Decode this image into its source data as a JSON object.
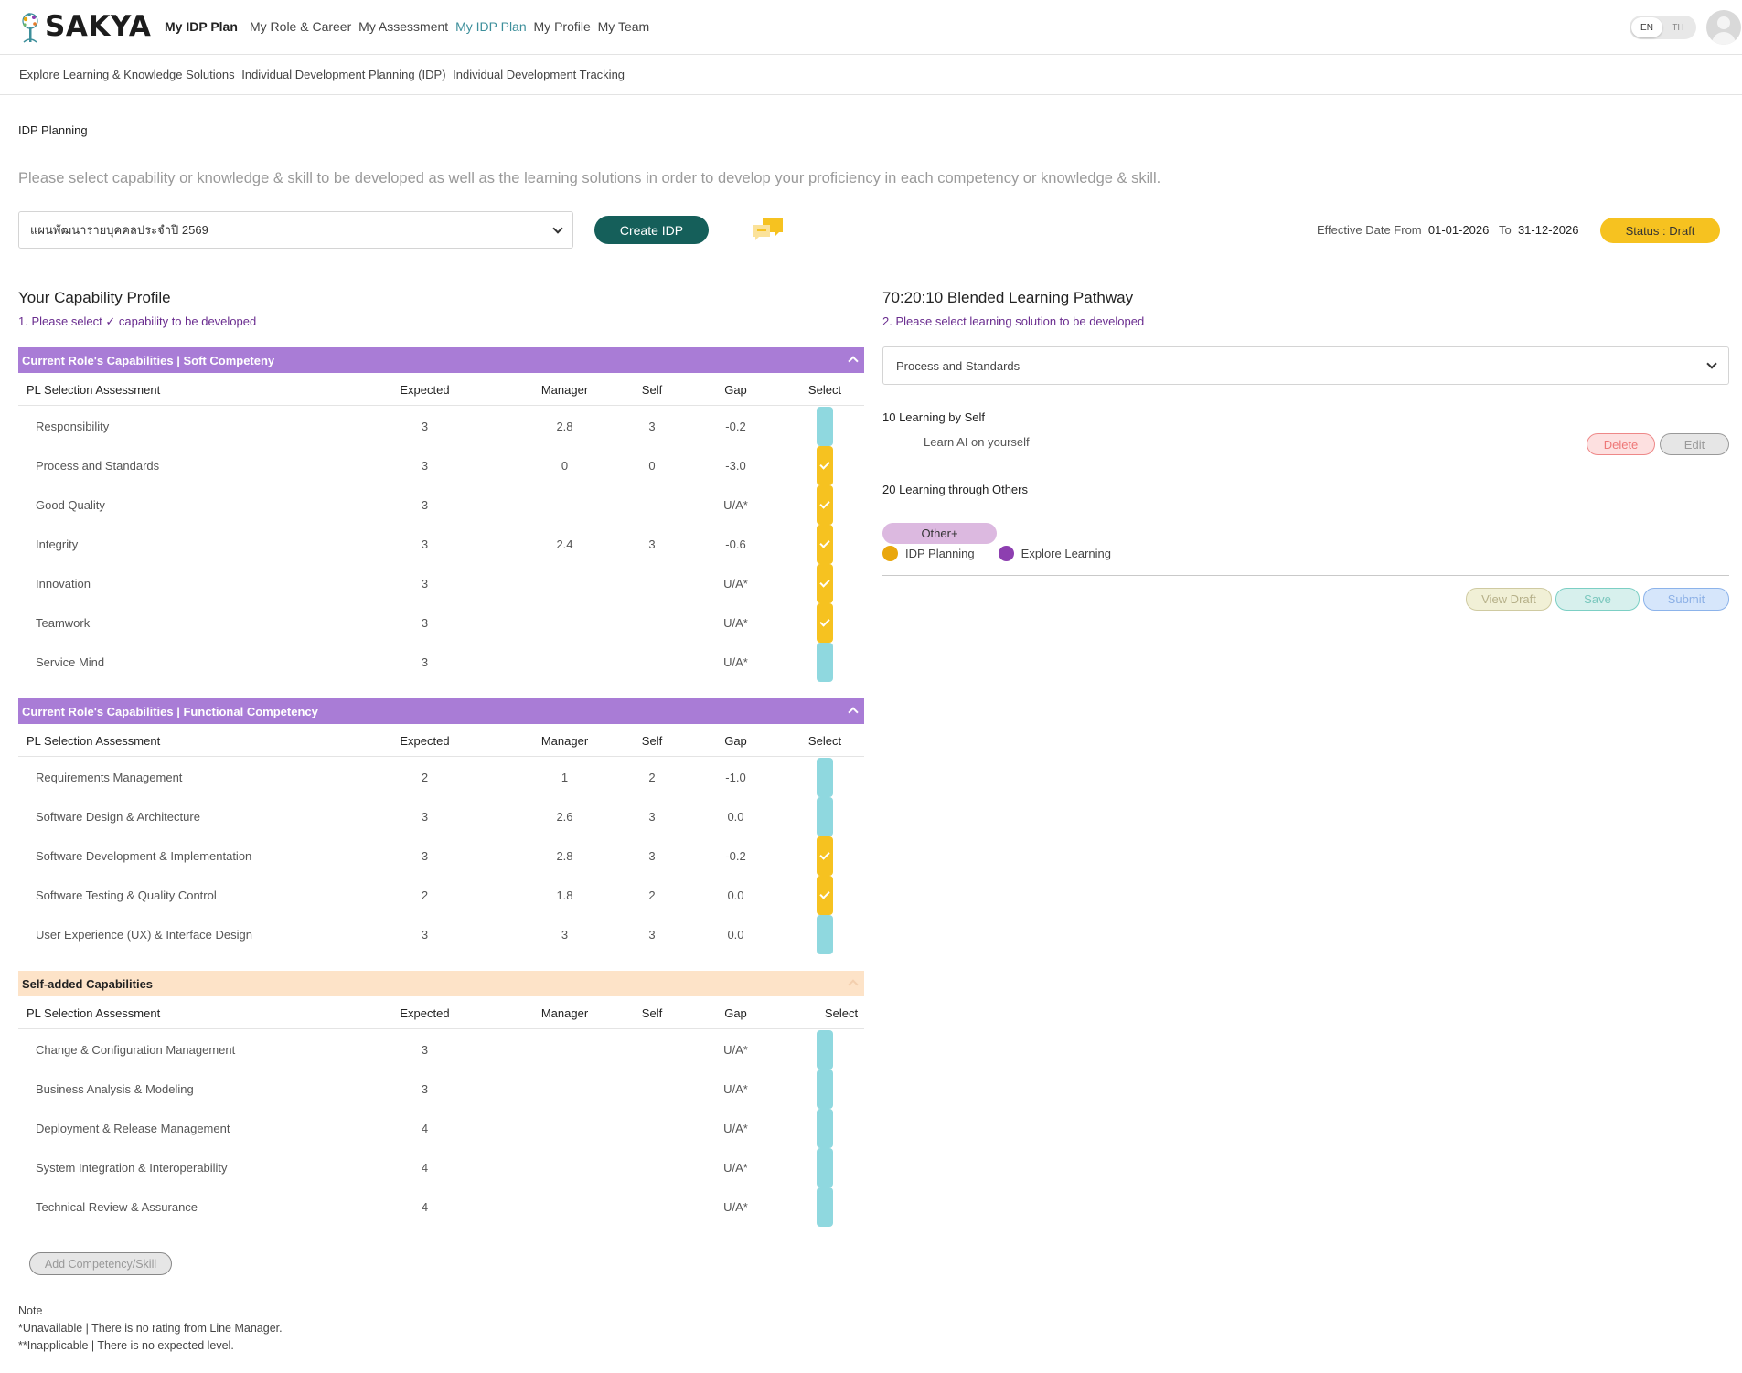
{
  "brand": {
    "name": "SAKYA"
  },
  "nav": {
    "current": "My IDP Plan",
    "links": [
      {
        "label": "My Role & Career",
        "active": false
      },
      {
        "label": "My Assessment",
        "active": false
      },
      {
        "label": "My IDP Plan",
        "active": true
      },
      {
        "label": "My Profile",
        "active": false
      },
      {
        "label": "My Team",
        "active": false
      }
    ],
    "lang": {
      "en": "EN",
      "th": "TH",
      "selected": "EN"
    }
  },
  "subnav": [
    "Explore Learning & Knowledge Solutions",
    "Individual Development Planning (IDP)",
    "Individual Development Tracking"
  ],
  "page": {
    "title": "IDP Planning",
    "instruction": "Please select capability or knowledge & skill to be developed as well as the learning solutions in order to develop your proficiency in each competency or knowledge & skill."
  },
  "controls": {
    "plan_select": "แผนพัฒนารายบุคคลประจำปี 2569",
    "create_button": "Create IDP",
    "effective_label": "Effective Date From",
    "date_from": "01-01-2026",
    "to_label": "To",
    "date_to": "31-12-2026",
    "status": "Status : Draft"
  },
  "profile": {
    "title": "Your Capability Profile",
    "subtitle": "1. Please select ✓ capability to be developed",
    "columns": {
      "name": "PL Selection Assessment",
      "expected": "Expected",
      "manager": "Manager",
      "self": "Self",
      "gap": "Gap",
      "select": "Select"
    },
    "groups": [
      {
        "title": "Current Role's Capabilities | Soft Competeny",
        "rows": [
          {
            "name": "Responsibility",
            "expected": "3",
            "manager": "2.8",
            "self": "3",
            "gap": "-0.2",
            "selected": false
          },
          {
            "name": "Process and Standards",
            "expected": "3",
            "manager": "0",
            "self": "0",
            "gap": "-3.0",
            "selected": true
          },
          {
            "name": "Good Quality",
            "expected": "3",
            "manager": "",
            "self": "",
            "gap": "U/A*",
            "selected": true
          },
          {
            "name": "Integrity",
            "expected": "3",
            "manager": "2.4",
            "self": "3",
            "gap": "-0.6",
            "selected": true
          },
          {
            "name": "Innovation",
            "expected": "3",
            "manager": "",
            "self": "",
            "gap": "U/A*",
            "selected": true
          },
          {
            "name": "Teamwork",
            "expected": "3",
            "manager": "",
            "self": "",
            "gap": "U/A*",
            "selected": true
          },
          {
            "name": "Service Mind",
            "expected": "3",
            "manager": "",
            "self": "",
            "gap": "U/A*",
            "selected": false
          }
        ]
      },
      {
        "title": "Current Role's Capabilities | Functional Competency",
        "rows": [
          {
            "name": "Requirements Management",
            "expected": "2",
            "manager": "1",
            "self": "2",
            "gap": "-1.0",
            "selected": false
          },
          {
            "name": "Software Design & Architecture",
            "expected": "3",
            "manager": "2.6",
            "self": "3",
            "gap": "0.0",
            "selected": false
          },
          {
            "name": "Software Development & Implementation",
            "expected": "3",
            "manager": "2.8",
            "self": "3",
            "gap": "-0.2",
            "selected": true
          },
          {
            "name": "Software Testing & Quality Control",
            "expected": "2",
            "manager": "1.8",
            "self": "2",
            "gap": "0.0",
            "selected": true
          },
          {
            "name": "User Experience (UX) & Interface Design",
            "expected": "3",
            "manager": "3",
            "self": "3",
            "gap": "0.0",
            "selected": false
          }
        ]
      },
      {
        "title": "Self-added Capabilities",
        "rows": [
          {
            "name": "Change & Configuration Management",
            "expected": "3",
            "manager": "",
            "self": "",
            "gap": "U/A*",
            "selected": false
          },
          {
            "name": "Business Analysis & Modeling",
            "expected": "3",
            "manager": "",
            "self": "",
            "gap": "U/A*",
            "selected": false
          },
          {
            "name": "Deployment & Release Management",
            "expected": "4",
            "manager": "",
            "self": "",
            "gap": "U/A*",
            "selected": false
          },
          {
            "name": "System Integration & Interoperability",
            "expected": "4",
            "manager": "",
            "self": "",
            "gap": "U/A*",
            "selected": false
          },
          {
            "name": "Technical Review & Assurance",
            "expected": "4",
            "manager": "",
            "self": "",
            "gap": "U/A*",
            "selected": false
          }
        ]
      }
    ],
    "add_button": "Add Competency/Skill",
    "notes": [
      "Note",
      "*Unavailable | There is no rating from Line Manager.",
      "**Inapplicable | There is no expected level."
    ]
  },
  "pathway": {
    "title": "70:20:10 Blended Learning Pathway",
    "subtitle": "2. Please select learning solution to be developed",
    "capability_select": "Process and Standards",
    "self_section": "10 Learning by Self",
    "self_item": "Learn AI on yourself",
    "delete": "Delete",
    "edit": "Edit",
    "others_section": "20 Learning through Others",
    "other_button": "Other+",
    "legend": [
      {
        "label": "IDP Planning",
        "color": "#e9a70d"
      },
      {
        "label": "Explore Learning",
        "color": "#8d3fb0"
      }
    ],
    "view_draft": "View Draft",
    "save": "Save",
    "submit": "Submit"
  }
}
